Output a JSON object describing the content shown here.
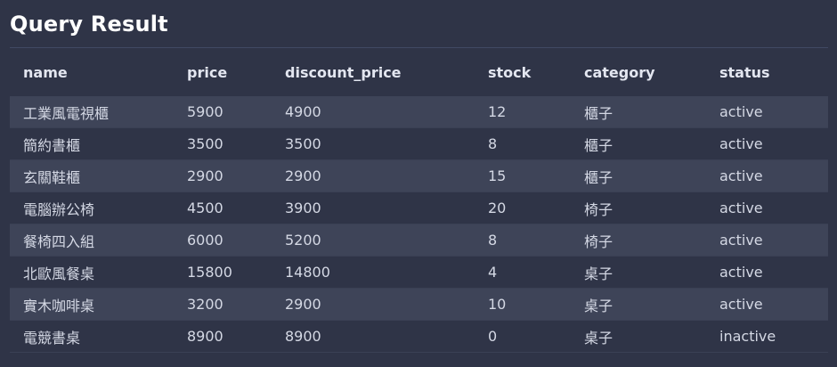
{
  "header": {
    "title": "Query Result"
  },
  "table": {
    "columns": [
      "name",
      "price",
      "discount_price",
      "stock",
      "category",
      "status"
    ],
    "rows": [
      [
        "工業風電視櫃",
        "5900",
        "4900",
        "12",
        "櫃子",
        "active"
      ],
      [
        "簡約書櫃",
        "3500",
        "3500",
        "8",
        "櫃子",
        "active"
      ],
      [
        "玄關鞋櫃",
        "2900",
        "2900",
        "15",
        "櫃子",
        "active"
      ],
      [
        "電腦辦公椅",
        "4500",
        "3900",
        "20",
        "椅子",
        "active"
      ],
      [
        "餐椅四入組",
        "6000",
        "5200",
        "8",
        "椅子",
        "active"
      ],
      [
        "北歐風餐桌",
        "15800",
        "14800",
        "4",
        "桌子",
        "active"
      ],
      [
        "實木咖啡桌",
        "3200",
        "2900",
        "10",
        "桌子",
        "active"
      ],
      [
        "電競書桌",
        "8900",
        "8900",
        "0",
        "桌子",
        "inactive"
      ]
    ]
  },
  "colors": {
    "background": "#2f3447",
    "row_alt": "#3e4458",
    "divider": "#414963",
    "title": "#ffffff",
    "text": "#d4d8e4"
  }
}
